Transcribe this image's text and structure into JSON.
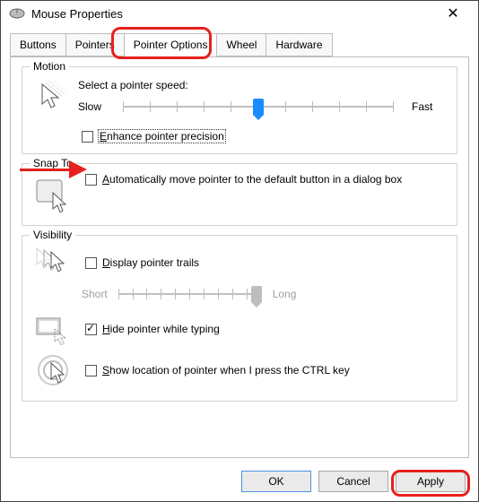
{
  "window": {
    "title": "Mouse Properties"
  },
  "tabs": [
    {
      "label": "Buttons"
    },
    {
      "label": "Pointers"
    },
    {
      "label": "Pointer Options"
    },
    {
      "label": "Wheel"
    },
    {
      "label": "Hardware"
    }
  ],
  "motion": {
    "legend": "Motion",
    "speed_label": "Select a pointer speed:",
    "slow": "Slow",
    "fast": "Fast",
    "speed_value": 5,
    "speed_min": 0,
    "speed_max": 10,
    "enhance": {
      "checked": false,
      "prefix": "E",
      "rest": "nhance pointer precision"
    }
  },
  "snap": {
    "legend": "Snap To",
    "auto": {
      "checked": false,
      "prefix": "A",
      "rest": "utomatically move pointer to the default button in a dialog box"
    }
  },
  "visibility": {
    "legend": "Visibility",
    "trails": {
      "checked": false,
      "prefix": "D",
      "rest": "isplay pointer trails",
      "short": "Short",
      "long": "Long",
      "value": 10,
      "min": 0,
      "max": 10
    },
    "hide": {
      "checked": true,
      "prefix": "H",
      "rest": "ide pointer while typing"
    },
    "ctrl": {
      "checked": false,
      "prefix": "S",
      "rest": "how location of pointer when I press the CTRL key"
    }
  },
  "buttons": {
    "ok": "OK",
    "cancel": "Cancel",
    "apply": "Apply"
  }
}
